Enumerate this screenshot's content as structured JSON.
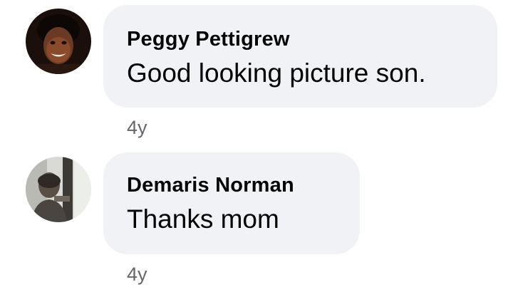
{
  "comments": [
    {
      "author": "Peggy Pettigrew",
      "text": "Good looking picture son.",
      "time": "4y",
      "avatar_icon": "profile-photo-icon"
    },
    {
      "author": "Demaris Norman",
      "text": "Thanks mom",
      "time": "4y",
      "avatar_icon": "profile-photo-icon"
    }
  ],
  "colors": {
    "bubble_bg": "#f0f2f5",
    "text": "#050505",
    "timestamp": "#65676b"
  }
}
